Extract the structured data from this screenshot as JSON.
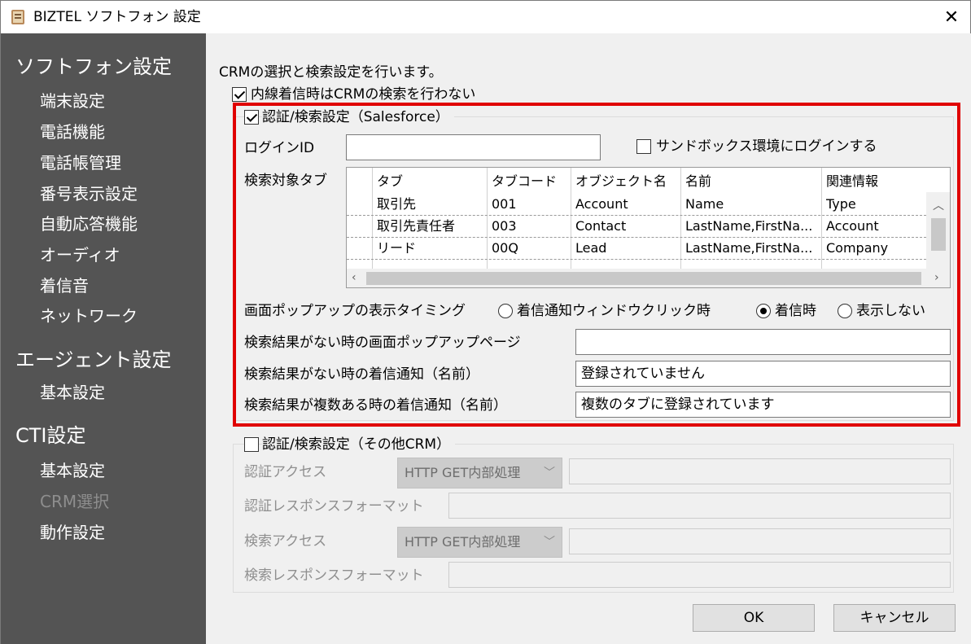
{
  "window": {
    "title": "BIZTEL ソフトフォン 設定",
    "close_glyph": "✕"
  },
  "sidebar": {
    "groups": [
      {
        "label": "ソフトフォン設定",
        "items": [
          "端末設定",
          "電話機能",
          "電話帳管理",
          "番号表示設定",
          "自動応答機能",
          "オーディオ",
          "着信音",
          "ネットワーク"
        ]
      },
      {
        "label": "エージェント設定",
        "items": [
          "基本設定"
        ]
      },
      {
        "label": "CTI設定",
        "items": [
          "基本設定",
          "CRM選択",
          "動作設定"
        ]
      }
    ],
    "selected_item": "CRM選択"
  },
  "main": {
    "description": "CRMの選択と検索設定を行います。",
    "skip_internal_label": "内線着信時はCRMの検索を行わない",
    "skip_internal_checked": true,
    "salesforce": {
      "group_label": "認証/検索設定（Salesforce）",
      "checked": true,
      "login_id_label": "ログインID",
      "login_id_value": "",
      "sandbox_label": "サンドボックス環境にログインする",
      "sandbox_checked": false,
      "search_tab_label": "検索対象タブ",
      "grid": {
        "columns": [
          "タブ",
          "タブコード",
          "オブジェクト名",
          "名前",
          "関連情報"
        ],
        "rows": [
          [
            "取引先",
            "001",
            "Account",
            "Name",
            "Type"
          ],
          [
            "取引先責任者",
            "003",
            "Contact",
            "LastName,FirstNa...",
            "Account"
          ],
          [
            "リード",
            "00Q",
            "Lead",
            "LastName,FirstNa...",
            "Company"
          ]
        ]
      },
      "popup_timing_label": "画面ポップアップの表示タイミング",
      "popup_options": [
        "着信通知ウィンドウクリック時",
        "着信時",
        "表示しない"
      ],
      "popup_selected": "着信時",
      "no_result_page_label": "検索結果がない時の画面ポップアップページ",
      "no_result_page_value": "",
      "no_result_notice_label": "検索結果がない時の着信通知（名前）",
      "no_result_notice_value": "登録されていません",
      "multi_result_notice_label": "検索結果が複数ある時の着信通知（名前）",
      "multi_result_notice_value": "複数のタブに登録されています"
    },
    "other_crm": {
      "group_label": "認証/検索設定（その他CRM）",
      "checked": false,
      "auth_access_label": "認証アクセス",
      "auth_access_method": "HTTP GET内部処理",
      "auth_access_url": "",
      "auth_response_label": "認証レスポンスフォーマット",
      "auth_response_value": "",
      "search_access_label": "検索アクセス",
      "search_access_method": "HTTP GET内部処理",
      "search_access_url": "",
      "search_response_label": "検索レスポンスフォーマット",
      "search_response_value": ""
    },
    "buttons": {
      "ok": "OK",
      "cancel": "キャンセル"
    }
  },
  "icons": {
    "app": "phone-book-icon",
    "close": "close-icon",
    "scroll_up": "chevron-up-icon",
    "scroll_left": "chevron-left-icon",
    "scroll_right": "chevron-right-icon",
    "combo": "chevron-down-icon"
  },
  "colors": {
    "sidebar_bg": "#545454",
    "highlight_border": "#e00000"
  }
}
